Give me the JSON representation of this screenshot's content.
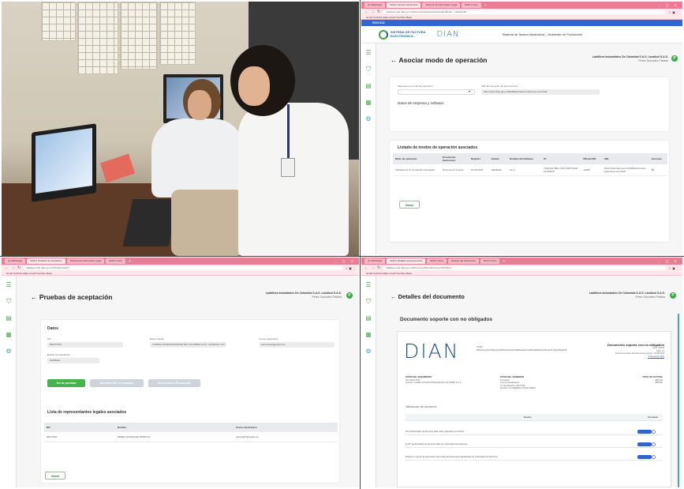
{
  "browser_top_right": {
    "tabs": [
      "(1) WhatsApp",
      "DIAN | Factura electrónica",
      "Sistema de Información Legal",
      "DIAN | Inicio"
    ],
    "url": "catalogo-vpfe.dian.gov.co/Document/AssociateOperationMode?...softwareId=...",
    "bookmarks": "Gmail   YouTube   Maps   Gmail   YouTube   Maps"
  },
  "browser_bottom_left": {
    "tabs": [
      "(1) WhatsApp",
      "DIAN | Pruebas de aceptación",
      "Sistema de Información Legal",
      "DIAN | Inicio"
    ],
    "url": "catalogo-vpfe.dian.gov.co/TestSet/Index?...",
    "bookmarks": "Gmail   YouTube   Maps   Gmail   YouTube   Maps"
  },
  "browser_bottom_right": {
    "tabs": [
      "(1) WhatsApp",
      "DIAN | Detalles del documento",
      "DIAN | Inicio",
      "Gestión del documento",
      "DIAN | Inicio"
    ],
    "url": "catalogo-vpfe.dian.gov.co/Document/ShowDocumentToPublic/...",
    "bookmarks": "Gmail   YouTube   Maps   Gmail   YouTube   Maps"
  },
  "gov": {
    "label": "GOV.CO"
  },
  "header": {
    "fe_logo_line1": "SISTEMA DE FACTURA",
    "fe_logo_line2": "ELECTRÓNICA",
    "dian_logo": "DIAN",
    "system_title": "Sistema de factura electrónica – Ambiente de Producción"
  },
  "user": {
    "company": "Ladrillera Industriales De Colombia S.A.S. Landicol S.A.S.",
    "name": "Perez Gonzalez Patricia",
    "initial": "P"
  },
  "operation_mode": {
    "title": "Asociar modo de operación",
    "select_label": "Seleccione el modo de operación",
    "url_label": "URL de recepción de documentos *",
    "url_value": "https://vpfe.dian.gov.co/WcfDianCustomerServices.svc?wsdl",
    "company_section": "Datos de empresa y software",
    "list_title": "Listado de modos de operación asociados",
    "columns": [
      "Modo de operación",
      "Documento Electrónico",
      "Registro",
      "Estado",
      "Nombre del Software",
      "ID",
      "PIN del SW",
      "URL",
      "Acciones"
    ],
    "rows": [
      [
        "Software de un proveedor tecnológico",
        "Documento Soporte",
        "10-08-2023",
        "Habilitado",
        "sw_2",
        "f47ac10b-58cc-4372-a567-0e02b2c3d479",
        "12345",
        "https://vpfe.dian.gov.co/WcfDianCustomerServices.svc?wsdl",
        ""
      ]
    ],
    "back_button": "Volver"
  },
  "acceptance": {
    "title": "Pruebas de aceptación",
    "data_section": "Datos",
    "nit_label": "NIT",
    "nit_value": "900277574",
    "razon_label": "Razón Social",
    "razon_value": "LADRILLOS INDUSTRIALES DE COLOMBIA S.A.S. LANDICOL S.A.S.",
    "email_label": "Correo electrónico",
    "email_value": "ladricolsas@gmail.com",
    "status_label": "Estado de aceptación",
    "status_value": "Habilitado",
    "btn_test_set": "Set de pruebas",
    "btn_reset": "Reiniciar SET de pruebas",
    "btn_production": "Sincronizar a Producción",
    "reps_title": "Lista de representantes legales asociados",
    "rep_columns": [
      "NIT",
      "Nombre",
      "Correo electrónico"
    ],
    "rep_rows": [
      [
        "94077520",
        "PEREZ GONZALEZ PATRICIA",
        "patrpe207@yahoo.es"
      ]
    ],
    "back_button": "Volver"
  },
  "document": {
    "title": "Detalles del documento",
    "subtitle": "Documento soporte con no obligados",
    "dian_logo": "DIAN",
    "cufe_text": "CUDS: 9f8a3c41e20b7d5a6c18e9f04b2d7a3c5e61f08b94a2d7c3e5f10a8b6d4c2e9f1a3b5c7d9e0f2a4b6c8",
    "doc_type": "Documento soporte con no obligados",
    "doc_number": "Serie: DSNO",
    "doc_no": "Folio: 12",
    "doc_date": "Fecha de emisión del documento soporte: 10-08-2023",
    "doc_link": "Descargar PDF",
    "buyer_title": "DATOS DEL ADQUIRIENTE",
    "buyer_nit": "NIT: 900277574",
    "buyer_name": "Nombre: LADRILLOS INDUSTRIALES DE COLOMBIA S.A.S.",
    "seller_title": "DATOS DEL VENDEDOR",
    "seller_kind": "Proveedor",
    "seller_type": "Tipo de identificación:",
    "seller_id": "N° Identificación: 94077520",
    "seller_name": "Nombre: GUTIERREZ CONDE FREDY",
    "totals_title": "TOTAL DE FACTURA",
    "total_1": "$85.000",
    "total_2": "$85.000",
    "events_title": "Validaciones del documento",
    "events_col_name": "Nombre",
    "events_col_result": "Resultado",
    "events": [
      "NIT del Prestador de Servicios debe estar registrado en la DIAN",
      "El NIT del Prestador de Servicios debe ser informado correctamente",
      "Existe en el grupo de información del emisor del documento identificado por el Prestador de Servicios"
    ]
  }
}
